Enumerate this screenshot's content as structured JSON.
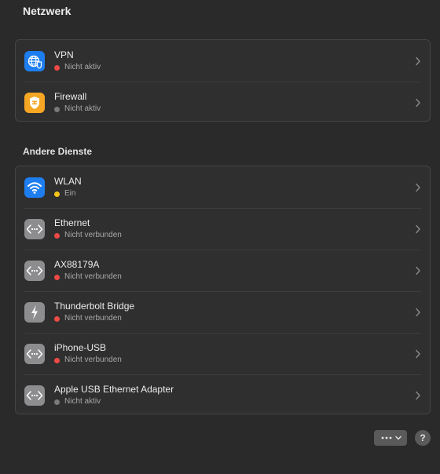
{
  "page": {
    "title": "Netzwerk"
  },
  "colors": {
    "status_red": "#ef4a45",
    "status_gray": "#7a7a7a",
    "status_yellow": "#f5c518",
    "accent_blue": "#1e7ef0",
    "accent_orange": "#f5a623"
  },
  "top_group": {
    "items": [
      {
        "name": "VPN",
        "status": "Nicht aktiv",
        "status_color": "red",
        "icon": "vpn-globe-icon"
      },
      {
        "name": "Firewall",
        "status": "Nicht aktiv",
        "status_color": "gray",
        "icon": "firewall-shield-icon"
      }
    ]
  },
  "other_services": {
    "title": "Andere Dienste",
    "items": [
      {
        "name": "WLAN",
        "status": "Ein",
        "status_color": "yellow",
        "icon": "wifi-icon"
      },
      {
        "name": "Ethernet",
        "status": "Nicht verbunden",
        "status_color": "red",
        "icon": "ethernet-icon"
      },
      {
        "name": "AX88179A",
        "status": "Nicht verbunden",
        "status_color": "red",
        "icon": "ethernet-icon"
      },
      {
        "name": "Thunderbolt Bridge",
        "status": "Nicht verbunden",
        "status_color": "red",
        "icon": "thunderbolt-icon"
      },
      {
        "name": "iPhone-USB",
        "status": "Nicht verbunden",
        "status_color": "red",
        "icon": "ethernet-icon"
      },
      {
        "name": "Apple USB Ethernet Adapter",
        "status": "Nicht aktiv",
        "status_color": "gray",
        "icon": "ethernet-icon"
      }
    ]
  },
  "footer": {
    "more_button": "more-actions-icon",
    "help_button": "?"
  }
}
